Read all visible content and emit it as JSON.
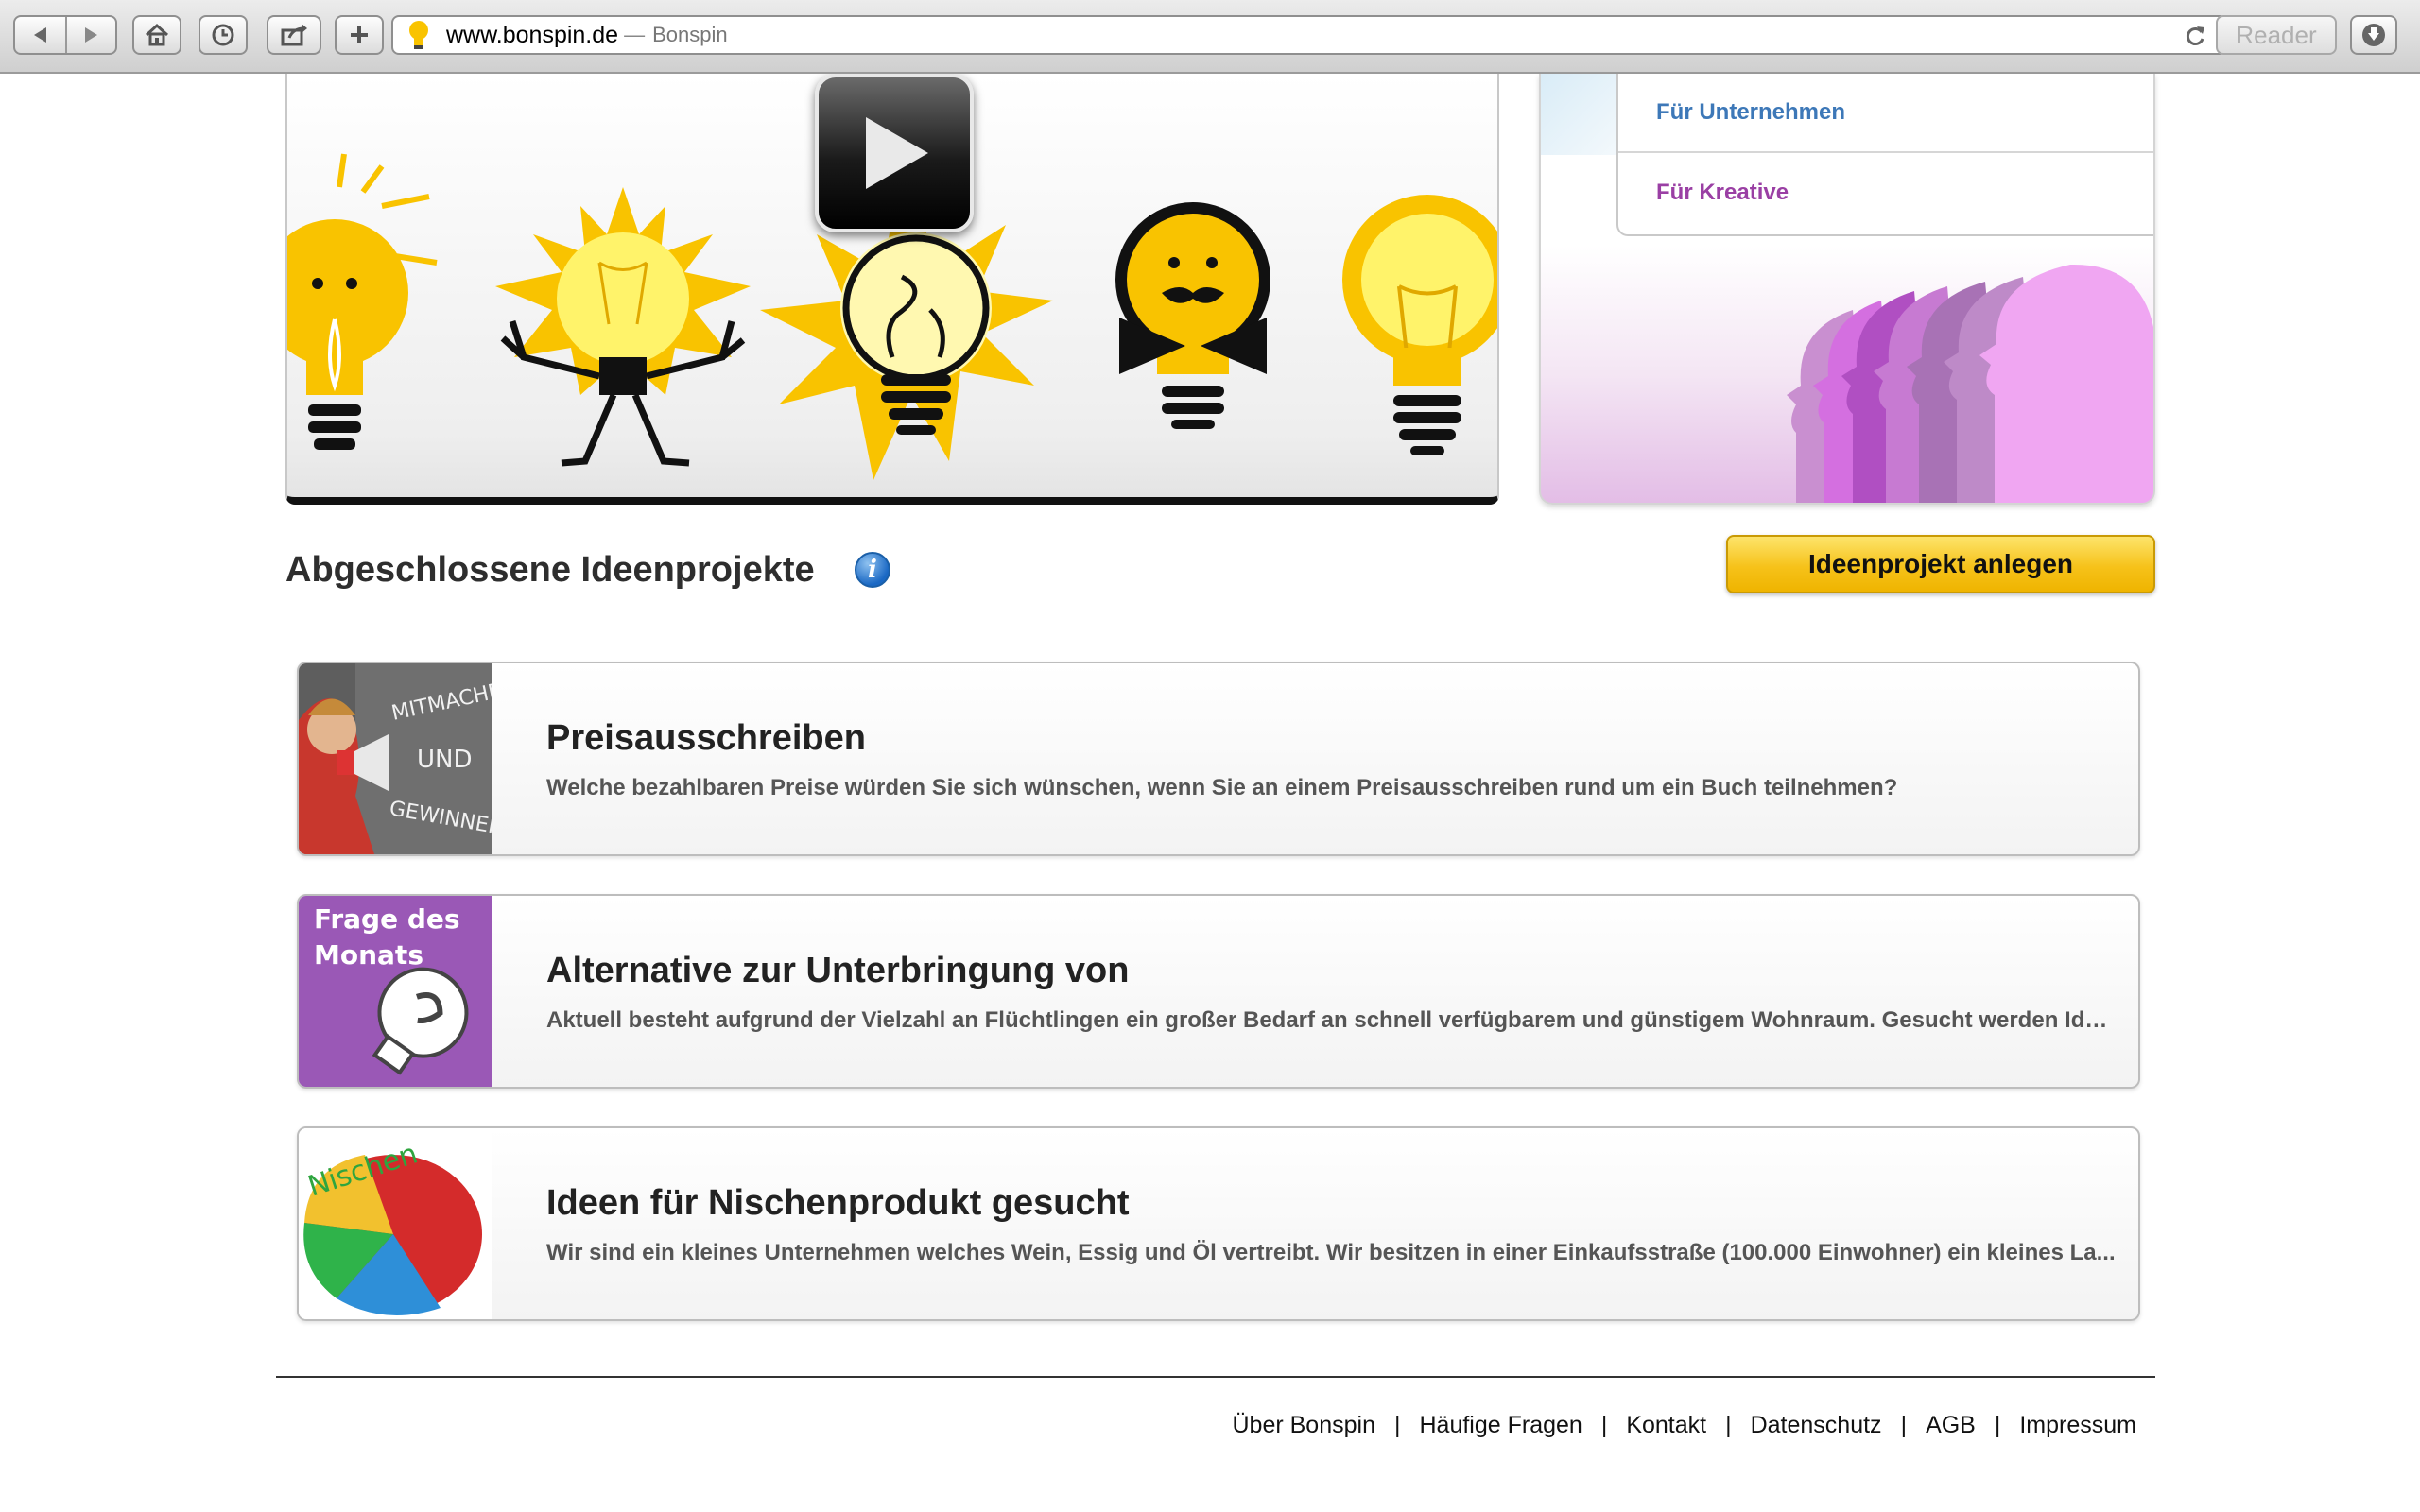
{
  "browser": {
    "url": "www.bonspin.de",
    "separator": "—",
    "page_title": "Bonspin",
    "reader_label": "Reader",
    "icons": [
      "back-arrow-icon",
      "forward-arrow-icon",
      "home-icon",
      "history-icon",
      "share-icon",
      "new-tab-plus-icon",
      "reload-icon",
      "downloads-icon"
    ]
  },
  "side_menu": {
    "items": [
      {
        "label": "Für Unternehmen"
      },
      {
        "label": "Für Kreative"
      }
    ]
  },
  "section": {
    "title": "Abgeschlossene Ideenprojekte",
    "info_glyph": "i",
    "create_button": "Ideenprojekt anlegen"
  },
  "projects": [
    {
      "title": "Preisausschreiben",
      "description": "Welche bezahlbaren Preise würden Sie sich wünschen, wenn Sie an einem Preisausschreiben rund um ein Buch teilnehmen?",
      "thumb_text": [
        "MITMACHEN",
        "UND",
        "GEWINNEN!"
      ]
    },
    {
      "title": "Alternative zur Unterbringung von",
      "description": "Aktuell besteht aufgrund der Vielzahl an Flüchtlingen ein großer Bedarf an schnell verfügbarem und günstigem Wohnraum. Gesucht werden Ide...",
      "thumb_text": [
        "Frage des",
        "Monats"
      ]
    },
    {
      "title": "Ideen für Nischenprodukt gesucht",
      "description": "Wir sind ein kleines Unternehmen welches Wein, Essig und Öl vertreibt. Wir besitzen in einer Einkaufsstraße (100.000 Einwohner) ein kleines La...",
      "thumb_text": [
        "Nischen"
      ]
    }
  ],
  "footer": {
    "links": [
      {
        "label": "Über Bonspin"
      },
      {
        "label": "Häufige Fragen"
      },
      {
        "label": "Kontakt"
      },
      {
        "label": "Datenschutz"
      },
      {
        "label": "AGB"
      },
      {
        "label": "Impressum"
      }
    ],
    "divider": "|"
  },
  "colors": {
    "link_blue": "#3d78b8",
    "link_purple": "#9a3fa4",
    "button_yellow": "#f6c21a",
    "bulb_yellow": "#f9c300"
  }
}
